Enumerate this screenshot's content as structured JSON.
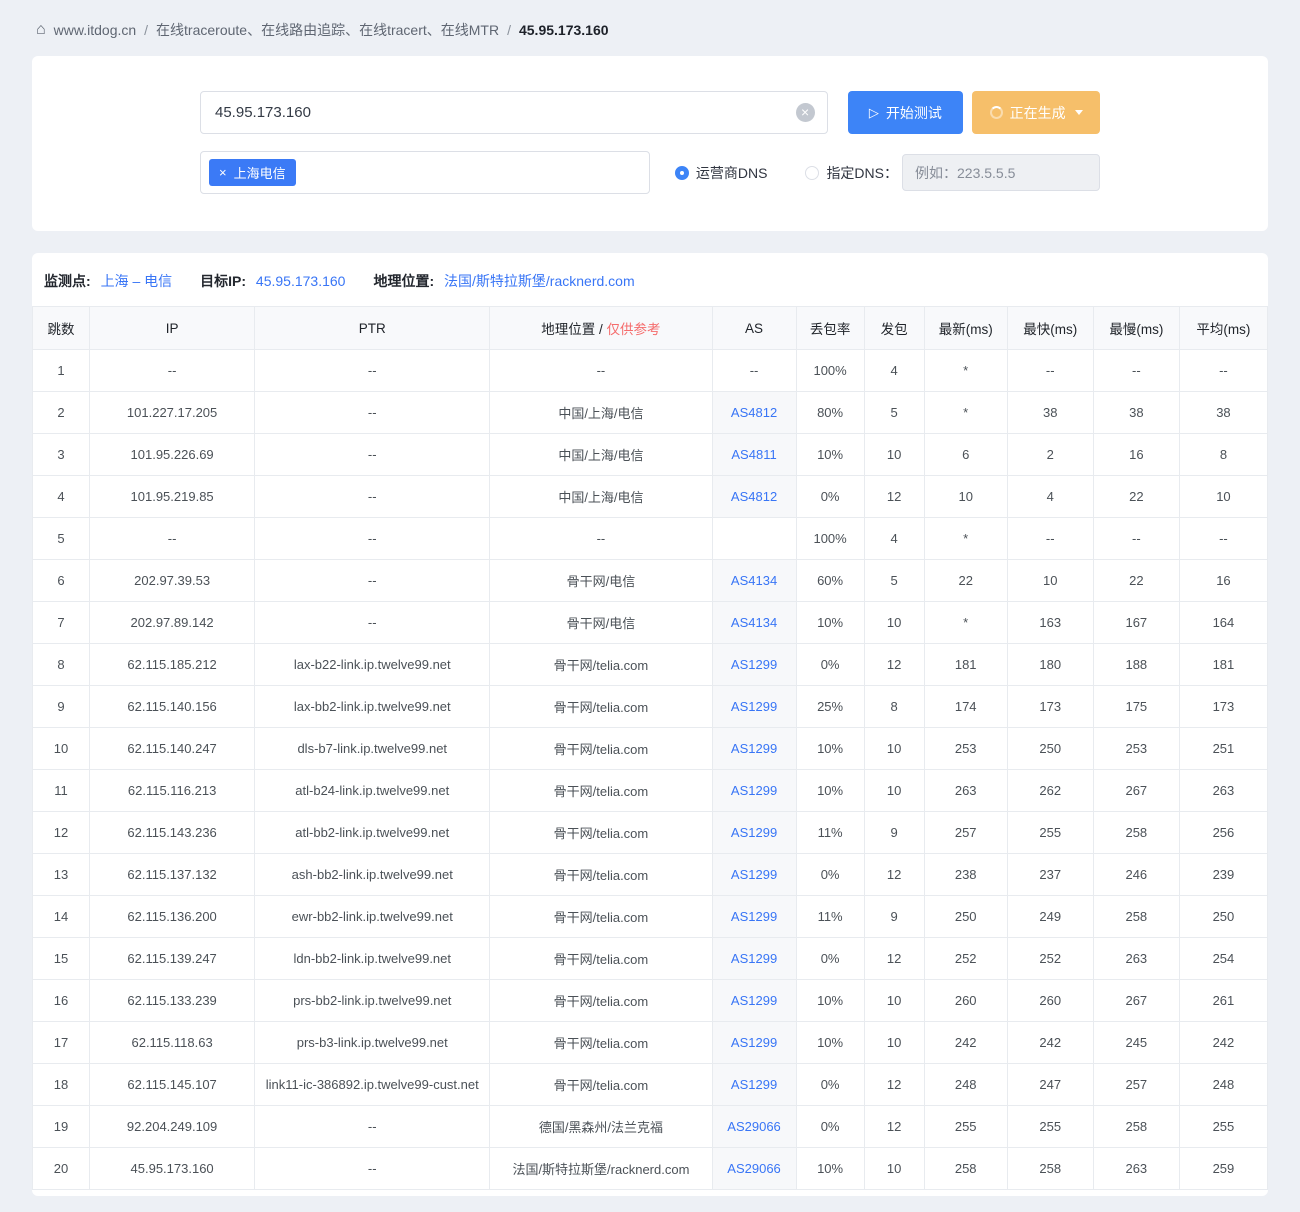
{
  "colors": {
    "primary": "#3d84f7",
    "warning": "#f6bf6a",
    "link": "#3875f6",
    "danger": "#f56c6c",
    "tag": "#3b7af6"
  },
  "breadcrumb": {
    "site": "www.itdog.cn",
    "separator": "/",
    "section": "在线traceroute、在线路由追踪、在线tracert、在线MTR",
    "current": "45.95.173.160"
  },
  "controls": {
    "target_value": "45.95.173.160",
    "start_label": "开始测试",
    "generating_label": "正在生成",
    "node_tag_label": "上海电信",
    "tag_close": "×",
    "clear_icon": "×",
    "isp_dns_label": "运营商DNS",
    "custom_dns_label": "指定DNS：",
    "dns_placeholder": "例如：223.5.5.5"
  },
  "summary": {
    "monitor_label": "监测点:",
    "monitor_value": "上海 – 电信",
    "target_label": "目标IP:",
    "target_value": "45.95.173.160",
    "geo_label": "地理位置:",
    "geo_value": "法国/斯特拉斯堡/racknerd.com"
  },
  "table": {
    "headers": [
      {
        "label": "跳数"
      },
      {
        "label": "IP"
      },
      {
        "label": "PTR"
      },
      {
        "label": "地理位置 / ",
        "note": "仅供参考"
      },
      {
        "label": "AS"
      },
      {
        "label": "丢包率"
      },
      {
        "label": "发包"
      },
      {
        "label": "最新(ms)"
      },
      {
        "label": "最快(ms)"
      },
      {
        "label": "最慢(ms)"
      },
      {
        "label": "平均(ms)"
      }
    ],
    "rows": [
      [
        "1",
        "--",
        "--",
        "--",
        "--",
        "100%",
        "4",
        "*",
        "--",
        "--",
        "--"
      ],
      [
        "2",
        "101.227.17.205",
        "--",
        "中国/上海/电信",
        "AS4812",
        "80%",
        "5",
        "*",
        "38",
        "38",
        "38"
      ],
      [
        "3",
        "101.95.226.69",
        "--",
        "中国/上海/电信",
        "AS4811",
        "10%",
        "10",
        "6",
        "2",
        "16",
        "8"
      ],
      [
        "4",
        "101.95.219.85",
        "--",
        "中国/上海/电信",
        "AS4812",
        "0%",
        "12",
        "10",
        "4",
        "22",
        "10"
      ],
      [
        "5",
        "--",
        "--",
        "--",
        "",
        "100%",
        "4",
        "*",
        "--",
        "--",
        "--"
      ],
      [
        "6",
        "202.97.39.53",
        "--",
        "骨干网/电信",
        "AS4134",
        "60%",
        "5",
        "22",
        "10",
        "22",
        "16"
      ],
      [
        "7",
        "202.97.89.142",
        "--",
        "骨干网/电信",
        "AS4134",
        "10%",
        "10",
        "*",
        "163",
        "167",
        "164"
      ],
      [
        "8",
        "62.115.185.212",
        "lax-b22-link.ip.twelve99.net",
        "骨干网/telia.com",
        "AS1299",
        "0%",
        "12",
        "181",
        "180",
        "188",
        "181"
      ],
      [
        "9",
        "62.115.140.156",
        "lax-bb2-link.ip.twelve99.net",
        "骨干网/telia.com",
        "AS1299",
        "25%",
        "8",
        "174",
        "173",
        "175",
        "173"
      ],
      [
        "10",
        "62.115.140.247",
        "dls-b7-link.ip.twelve99.net",
        "骨干网/telia.com",
        "AS1299",
        "10%",
        "10",
        "253",
        "250",
        "253",
        "251"
      ],
      [
        "11",
        "62.115.116.213",
        "atl-b24-link.ip.twelve99.net",
        "骨干网/telia.com",
        "AS1299",
        "10%",
        "10",
        "263",
        "262",
        "267",
        "263"
      ],
      [
        "12",
        "62.115.143.236",
        "atl-bb2-link.ip.twelve99.net",
        "骨干网/telia.com",
        "AS1299",
        "11%",
        "9",
        "257",
        "255",
        "258",
        "256"
      ],
      [
        "13",
        "62.115.137.132",
        "ash-bb2-link.ip.twelve99.net",
        "骨干网/telia.com",
        "AS1299",
        "0%",
        "12",
        "238",
        "237",
        "246",
        "239"
      ],
      [
        "14",
        "62.115.136.200",
        "ewr-bb2-link.ip.twelve99.net",
        "骨干网/telia.com",
        "AS1299",
        "11%",
        "9",
        "250",
        "249",
        "258",
        "250"
      ],
      [
        "15",
        "62.115.139.247",
        "ldn-bb2-link.ip.twelve99.net",
        "骨干网/telia.com",
        "AS1299",
        "0%",
        "12",
        "252",
        "252",
        "263",
        "254"
      ],
      [
        "16",
        "62.115.133.239",
        "prs-bb2-link.ip.twelve99.net",
        "骨干网/telia.com",
        "AS1299",
        "10%",
        "10",
        "260",
        "260",
        "267",
        "261"
      ],
      [
        "17",
        "62.115.118.63",
        "prs-b3-link.ip.twelve99.net",
        "骨干网/telia.com",
        "AS1299",
        "10%",
        "10",
        "242",
        "242",
        "245",
        "242"
      ],
      [
        "18",
        "62.115.145.107",
        "link11-ic-386892.ip.twelve99-cust.net",
        "骨干网/telia.com",
        "AS1299",
        "0%",
        "12",
        "248",
        "247",
        "257",
        "248"
      ],
      [
        "19",
        "92.204.249.109",
        "--",
        "德国/黑森州/法兰克福",
        "AS29066",
        "0%",
        "12",
        "255",
        "255",
        "258",
        "255"
      ],
      [
        "20",
        "45.95.173.160",
        "--",
        "法国/斯特拉斯堡/racknerd.com",
        "AS29066",
        "10%",
        "10",
        "258",
        "258",
        "263",
        "259"
      ]
    ]
  }
}
